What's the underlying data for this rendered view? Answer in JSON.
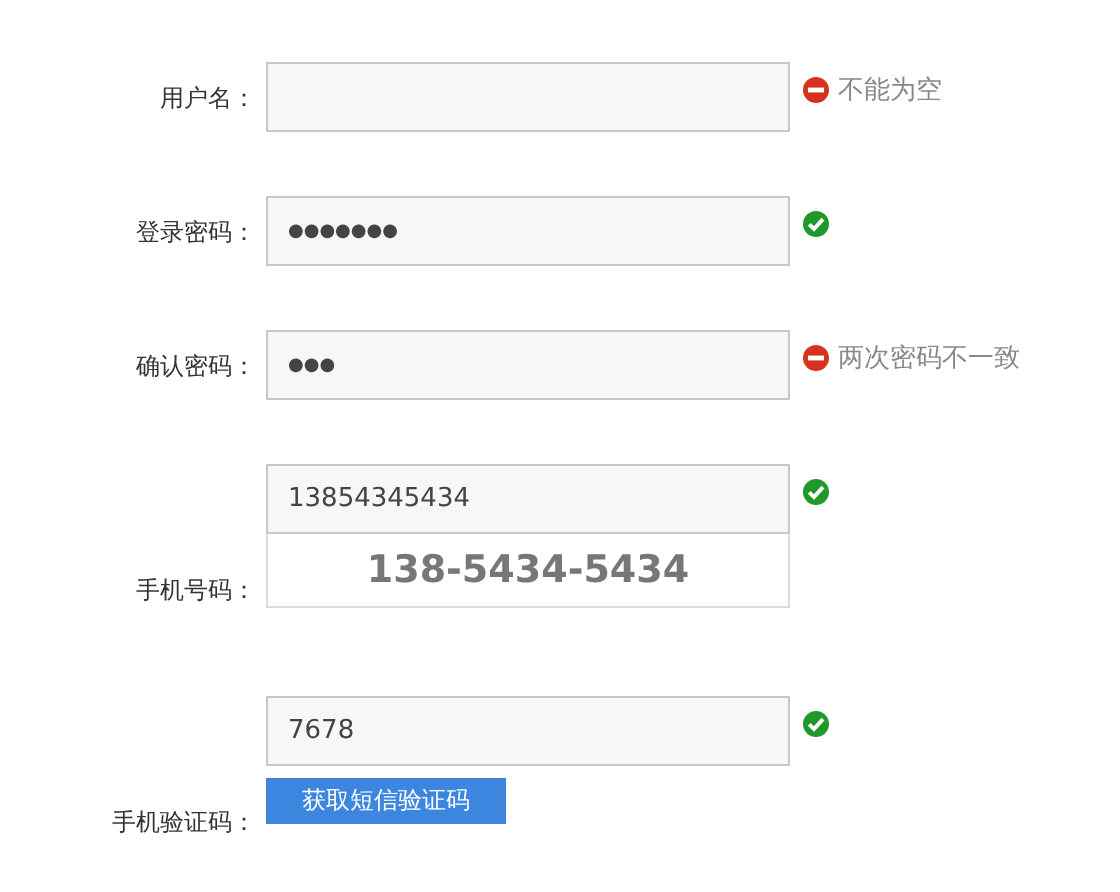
{
  "rows": [
    {
      "kind": "text",
      "label": "用户名：",
      "value": "",
      "valid": false,
      "message": "不能为空"
    },
    {
      "kind": "password",
      "label": "登录密码：",
      "value": "●●●●●●●",
      "valid": true
    },
    {
      "kind": "password",
      "label": "确认密码：",
      "value": "●●●",
      "valid": false,
      "message": "两次密码不一致"
    },
    {
      "kind": "phone",
      "label": "手机号码：",
      "value": "13854345434",
      "valid": true,
      "hint": "138-5434-5434"
    },
    {
      "kind": "code",
      "label": "手机验证码：",
      "value": "7678",
      "valid": true,
      "button": "获取短信验证码"
    }
  ]
}
